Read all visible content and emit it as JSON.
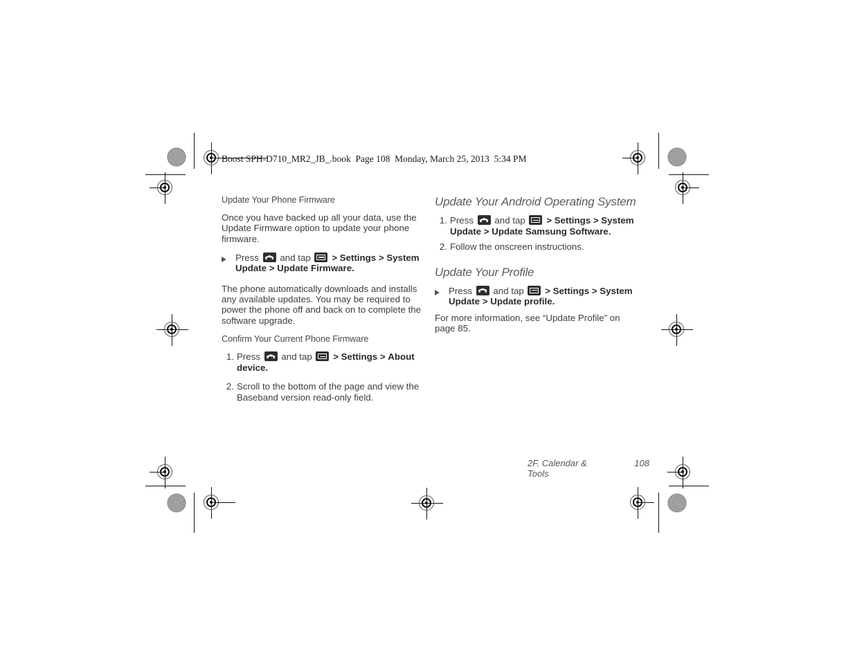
{
  "print": {
    "book_line": "Boost SPH-D710_MR2_JB_.book  Page 108  Monday, March 25, 2013  5:34 PM"
  },
  "left_column": {
    "sub_heading_1": "Update Your Phone Firmware",
    "paragraph_1": "Once you have backed up all your data, use the Update Firmware option to update your phone firmware.",
    "step_1": {
      "marker": "▶",
      "press_label": "Press",
      "home_icon": "home-key-icon",
      "and_tap_label": "and tap",
      "menu_icon": "menu-key-icon",
      "sep_1": ">",
      "path_1": "Settings",
      "sep_2": ">",
      "path_2": "System Update",
      "sep_3": ">",
      "path_3": "Update Firmware",
      "period": "."
    },
    "paragraph_2": "The phone automatically downloads and installs any available updates. You may be required to power the phone off and back on to complete the software upgrade.",
    "sub_heading_2": "Confirm Your Current Phone Firmware",
    "step_2": {
      "marker": "1.",
      "press_label": "Press",
      "home_icon": "home-key-icon",
      "and_tap_label": "and tap",
      "menu_icon": "menu-key-icon",
      "sep_1": ">",
      "path_1": "Settings",
      "sep_2": ">",
      "path_2": "About device",
      "period": "."
    },
    "step_3": {
      "marker": "2.",
      "text": "Scroll to the bottom of the page and view the Baseband version read-only field."
    }
  },
  "right_column": {
    "section_heading_1": "Update Your Android Operating System",
    "step_1": {
      "marker": "1.",
      "press_label": "Press",
      "home_icon": "home-key-icon",
      "and_tap_label": "and tap",
      "menu_icon": "menu-key-icon",
      "sep_1": ">",
      "path_1": "Settings",
      "sep_2": ">",
      "path_2": "System Update",
      "sep_3": ">",
      "path_3": "Update Samsung Software",
      "period": "."
    },
    "step_2": {
      "marker": "2.",
      "text": "Follow the onscreen instructions."
    },
    "section_heading_2": "Update Your Profile",
    "step_3": {
      "marker": "▶",
      "press_label": "Press",
      "home_icon": "home-key-icon",
      "and_tap_label": "and tap",
      "menu_icon": "menu-key-icon",
      "sep_1": ">",
      "path_1": "Settings",
      "sep_2": ">",
      "path_2": "System Update",
      "sep_3": ">",
      "path_3": "Update profile",
      "period": "."
    },
    "closing_note": "For more information, see “Update Profile” on page 85."
  },
  "footer": {
    "chapter": "2F. Calendar & Tools",
    "page_number": "108"
  },
  "colors": {
    "body_text": "#3d3d3d",
    "heading_text": "#5c5c5c",
    "bold_text": "#2b2b2b",
    "key_icon_bg": "#2e2e2e",
    "page_bg": "#ffffff"
  }
}
